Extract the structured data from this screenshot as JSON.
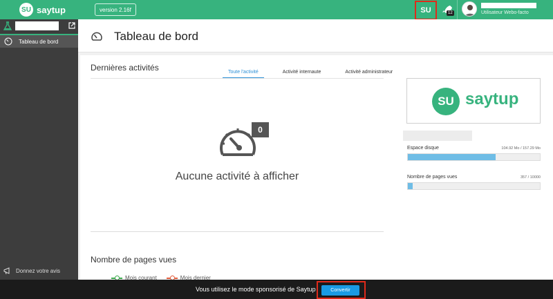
{
  "brand": {
    "name": "saytup",
    "badge": "SU"
  },
  "header": {
    "version_label": "version 2.16f",
    "su_button_label": "SU",
    "rocket_count": "12",
    "user_role": "Utilisateur Webo-facto"
  },
  "sidebar": {
    "items": [
      {
        "label": "Tableau de bord"
      }
    ],
    "feedback_label": "Donnez votre avis"
  },
  "page": {
    "title": "Tableau de bord"
  },
  "activities": {
    "title": "Dernières activités",
    "tabs": [
      {
        "label": "Toute l'activité",
        "active": true
      },
      {
        "label": "Activité internaute",
        "active": false
      },
      {
        "label": "Activité administrateur",
        "active": false
      }
    ],
    "count": "0",
    "empty_text": "Aucune activité à afficher"
  },
  "page_views": {
    "title": "Nombre de pages vues",
    "legend": [
      {
        "label": "Mois courant",
        "color": "#3aa84a"
      },
      {
        "label": "Mois dernier",
        "color": "#e05a3a"
      }
    ]
  },
  "stats": {
    "disk": {
      "label": "Espace disque",
      "value": "104.92 Mo / 157.29 Mo",
      "fraction": 0.667
    },
    "views": {
      "label": "Nombre de pages vues",
      "value": "357 / 10000",
      "fraction": 0.0357
    }
  },
  "footer": {
    "message": "Vous utilisez le mode sponsorisé de Saytup",
    "convert_label": "Convertir"
  },
  "colors": {
    "brand_green": "#37b37e",
    "sidebar": "#3d3d3d",
    "accent_blue": "#2b8fd6",
    "highlight_red": "#e02a1a"
  }
}
